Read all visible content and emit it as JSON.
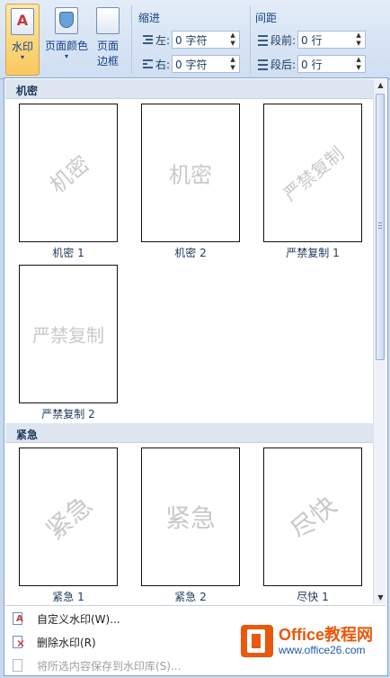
{
  "ribbon": {
    "watermark": {
      "label": "水印",
      "caret": "▾"
    },
    "page_color": {
      "label": "页面颜色",
      "caret": "▾"
    },
    "page_border": {
      "label_1": "页面",
      "label_2": "边框"
    },
    "indent": {
      "title": "缩进",
      "left_label": "左:",
      "left_value": "0 字符",
      "right_label": "右:",
      "right_value": "0 字符"
    },
    "spacing": {
      "title": "间距",
      "before_label": "段前:",
      "before_value": "0 行",
      "after_label": "段后:",
      "after_value": "0 行"
    }
  },
  "gallery": {
    "sections": [
      {
        "title": "机密",
        "items": [
          {
            "label": "机密 1",
            "watermark": "机密"
          },
          {
            "label": "机密 2",
            "watermark": "机密"
          },
          {
            "label": "严禁复制 1",
            "watermark": "严禁复制"
          },
          {
            "label": "严禁复制 2",
            "watermark": "严禁复制"
          }
        ]
      },
      {
        "title": "紧急",
        "items": [
          {
            "label": "紧急 1",
            "watermark": "紧急"
          },
          {
            "label": "紧急 2",
            "watermark": "紧急"
          },
          {
            "label": "尽快 1",
            "watermark": "尽快"
          }
        ]
      }
    ]
  },
  "menu": {
    "custom": "自定义水印(W)...",
    "remove": "删除水印(R)",
    "save": "将所选内容保存到水印库(S)..."
  },
  "logo": {
    "main": "Office教程网",
    "sub": "www.office26.com"
  }
}
